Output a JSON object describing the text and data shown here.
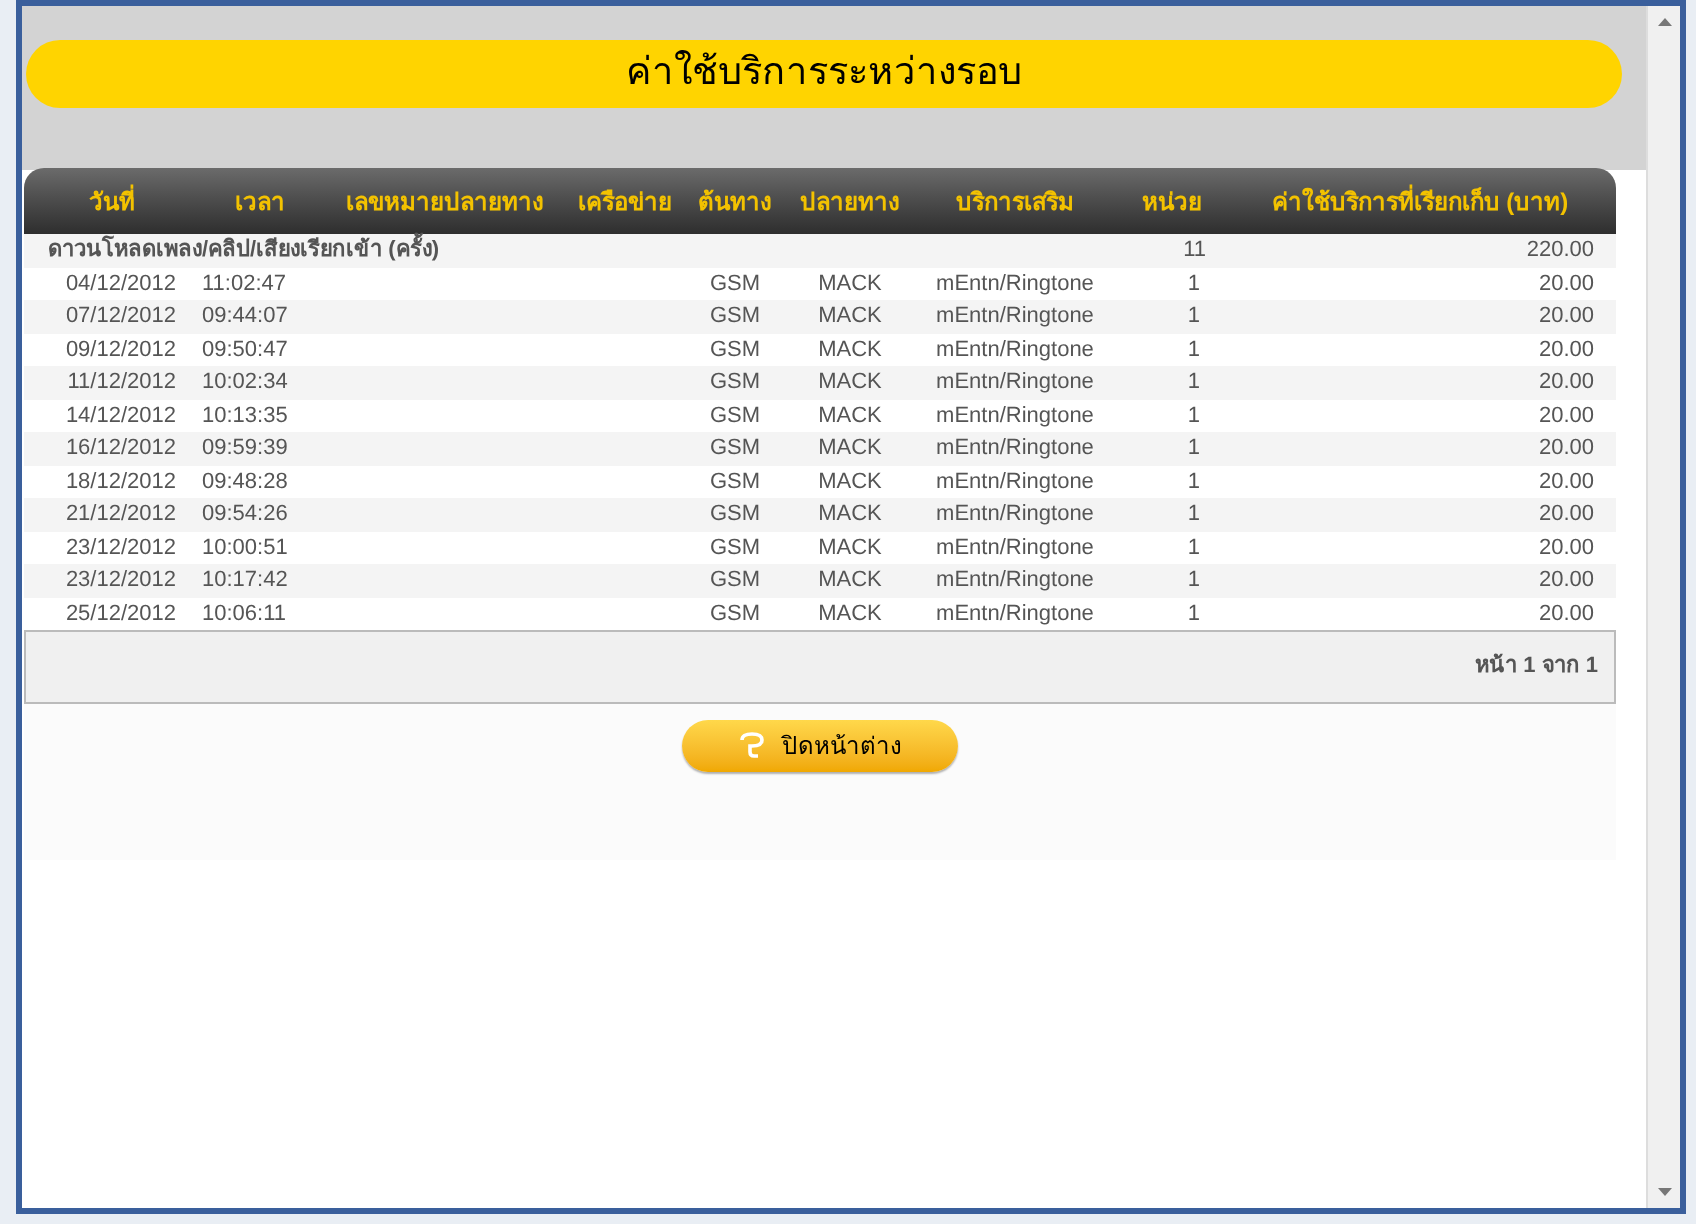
{
  "dialog": {
    "title": "ค่าใช้บริการระหว่างรอบ"
  },
  "table": {
    "columns": [
      "วันที่",
      "เวลา",
      "เลขหมายปลายทาง",
      "เครือข่าย",
      "ต้นทาง",
      "ปลายทาง",
      "บริการเสริม",
      "หน่วย",
      "ค่าใช้บริการที่เรียกเก็บ (บาท)"
    ],
    "group": {
      "label": "ดาวนโหลดเพลง/คลิป/เสียงเรียกเข้า (ครั้ง)",
      "units": "11",
      "charge": "220.00"
    },
    "rows": [
      {
        "date": "04/12/2012",
        "time": "11:02:47",
        "origin": "GSM",
        "destination": "MACK",
        "service": "mEntn/Ringtone",
        "units": "1",
        "charge": "20.00"
      },
      {
        "date": "07/12/2012",
        "time": "09:44:07",
        "origin": "GSM",
        "destination": "MACK",
        "service": "mEntn/Ringtone",
        "units": "1",
        "charge": "20.00"
      },
      {
        "date": "09/12/2012",
        "time": "09:50:47",
        "origin": "GSM",
        "destination": "MACK",
        "service": "mEntn/Ringtone",
        "units": "1",
        "charge": "20.00"
      },
      {
        "date": "11/12/2012",
        "time": "10:02:34",
        "origin": "GSM",
        "destination": "MACK",
        "service": "mEntn/Ringtone",
        "units": "1",
        "charge": "20.00"
      },
      {
        "date": "14/12/2012",
        "time": "10:13:35",
        "origin": "GSM",
        "destination": "MACK",
        "service": "mEntn/Ringtone",
        "units": "1",
        "charge": "20.00"
      },
      {
        "date": "16/12/2012",
        "time": "09:59:39",
        "origin": "GSM",
        "destination": "MACK",
        "service": "mEntn/Ringtone",
        "units": "1",
        "charge": "20.00"
      },
      {
        "date": "18/12/2012",
        "time": "09:48:28",
        "origin": "GSM",
        "destination": "MACK",
        "service": "mEntn/Ringtone",
        "units": "1",
        "charge": "20.00"
      },
      {
        "date": "21/12/2012",
        "time": "09:54:26",
        "origin": "GSM",
        "destination": "MACK",
        "service": "mEntn/Ringtone",
        "units": "1",
        "charge": "20.00"
      },
      {
        "date": "23/12/2012",
        "time": "10:00:51",
        "origin": "GSM",
        "destination": "MACK",
        "service": "mEntn/Ringtone",
        "units": "1",
        "charge": "20.00"
      },
      {
        "date": "23/12/2012",
        "time": "10:17:42",
        "origin": "GSM",
        "destination": "MACK",
        "service": "mEntn/Ringtone",
        "units": "1",
        "charge": "20.00"
      },
      {
        "date": "25/12/2012",
        "time": "10:06:11",
        "origin": "GSM",
        "destination": "MACK",
        "service": "mEntn/Ringtone",
        "units": "1",
        "charge": "20.00"
      }
    ],
    "pager": "หน้า 1 จาก 1"
  },
  "close_button": {
    "label": "ปิดหน้าต่าง"
  }
}
